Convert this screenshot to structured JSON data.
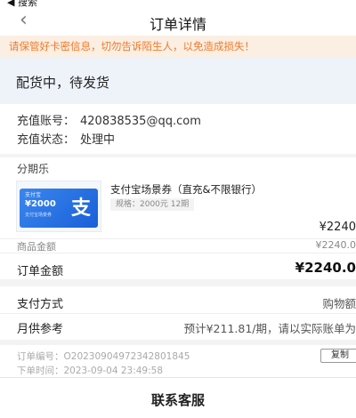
{
  "status_bar": {
    "back_to": "◀ 搜索"
  },
  "nav": {
    "back_icon": "‹",
    "title": "订单详情"
  },
  "warning": {
    "text": "请保管好卡密信息，切勿告诉陌生人，以免造成损失！"
  },
  "order_status": {
    "text": "配货中，待发货"
  },
  "recharge": {
    "account_label": "充值账号：",
    "account_value": "420838535@qq.com",
    "status_label": "充值状态：",
    "status_value": "处理中"
  },
  "seller": {
    "name": "分期乐"
  },
  "product": {
    "thumb": {
      "logo": "支付宝",
      "amount": "¥2000",
      "small": "支付宝场景券",
      "glyph": "支"
    },
    "name": "支付宝场景券（直充&不限银行）",
    "spec": "规格：2000元 12期",
    "price": "¥2240",
    "goods_amount_label": "商品金额",
    "goods_amount_value": "¥2240.0",
    "order_amount_label": "订单金额",
    "order_amount_value": "¥2240.0"
  },
  "payment": {
    "method_label": "支付方式",
    "method_value": "购物额",
    "monthly_label": "月供参考",
    "monthly_value": "预计¥211.81/期，请以实际账单为"
  },
  "order": {
    "number": "订单编号：O2023090497234280184​5",
    "time": "下单时间：2023-09-04 23:49:58",
    "copy_label": "复制"
  },
  "footer": {
    "contact": "联系客服"
  }
}
